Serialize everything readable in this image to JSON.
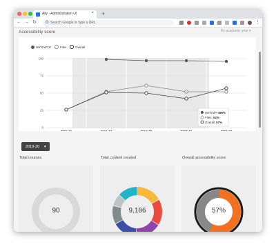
{
  "browser": {
    "tab_title": "Ally - Administration UI",
    "tab_close": "×",
    "new_tab": "+",
    "omnibox_placeholder": "Search Google or type a URL",
    "omnibox_g": "G",
    "colors": {
      "close": "#ff5f57",
      "minimize": "#febc2e",
      "maximize": "#28c840"
    }
  },
  "page": {
    "section_title": "Accessibility score",
    "view_select": "By academic year",
    "year_dropdown": "2019-20"
  },
  "chart_data": {
    "type": "line",
    "categories": [
      "2015-16",
      "2016-17",
      "2017-18",
      "2018-19",
      "2019-20"
    ],
    "ylim": [
      0,
      100
    ],
    "yticks": [
      0,
      25,
      50,
      75,
      100
    ],
    "grid": true,
    "legend": "top-left",
    "series": [
      {
        "name": "WYSIWYG",
        "values": [
          null,
          99,
          97,
          97,
          96
        ],
        "color": "#555555"
      },
      {
        "name": "Files",
        "values": [
          26,
          52,
          61,
          52,
          52
        ],
        "color": "#888888"
      },
      {
        "name": "Overall",
        "values": [
          26,
          51,
          50,
          42,
          57
        ],
        "color": "#444444"
      }
    ],
    "tooltip": [
      {
        "label": "WYSIWYG:",
        "value": "96%"
      },
      {
        "label": "Files:",
        "value": "52%"
      },
      {
        "label": "Overall:",
        "value": "57%"
      }
    ]
  },
  "stats": [
    {
      "title": "Total courses",
      "value": "90"
    },
    {
      "title": "Total content created",
      "value": "9,186"
    },
    {
      "title": "Overall accessibility score",
      "value": "57%"
    }
  ],
  "donut_content": [
    {
      "value": 17,
      "color": "#f6b93b"
    },
    {
      "value": 17,
      "color": "#e94b3c"
    },
    {
      "value": 17,
      "color": "#8e44ad"
    },
    {
      "value": 16,
      "color": "#3b4fa8"
    },
    {
      "value": 12,
      "color": "#7f8c8d"
    },
    {
      "value": 8,
      "color": "#bdc3c7"
    },
    {
      "value": 13,
      "color": "#1fb6cc"
    }
  ],
  "score_fraction": 0.57
}
